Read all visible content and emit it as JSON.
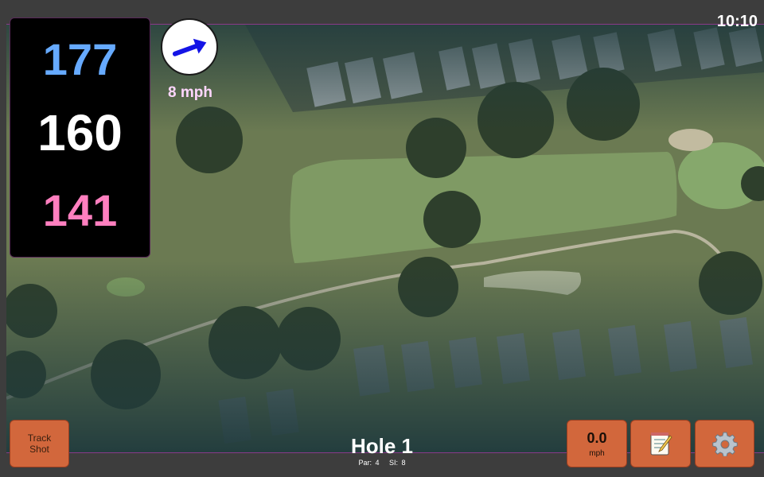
{
  "status": {
    "time": "10:10"
  },
  "yardage": {
    "back": "177",
    "center": "160",
    "front": "141"
  },
  "wind": {
    "speed": "8 mph",
    "direction_icon": "arrow-northeast-icon",
    "arrow_color": "#1414e6"
  },
  "hole": {
    "title": "Hole 1",
    "par": "Par: 4",
    "si": "SI: 8"
  },
  "buttons": {
    "track_shot_line1": "Track",
    "track_shot_line2": "Shot",
    "speed_value": "0.0",
    "speed_unit": "mph",
    "notes_icon": "notepad-icon",
    "settings_icon": "gear-icon"
  },
  "colors": {
    "button": "#d2673c",
    "back_yardage": "#66aaff",
    "center_yardage": "#ffffff",
    "front_yardage": "#ff7fbf",
    "wind_text": "#ffd6ff"
  }
}
